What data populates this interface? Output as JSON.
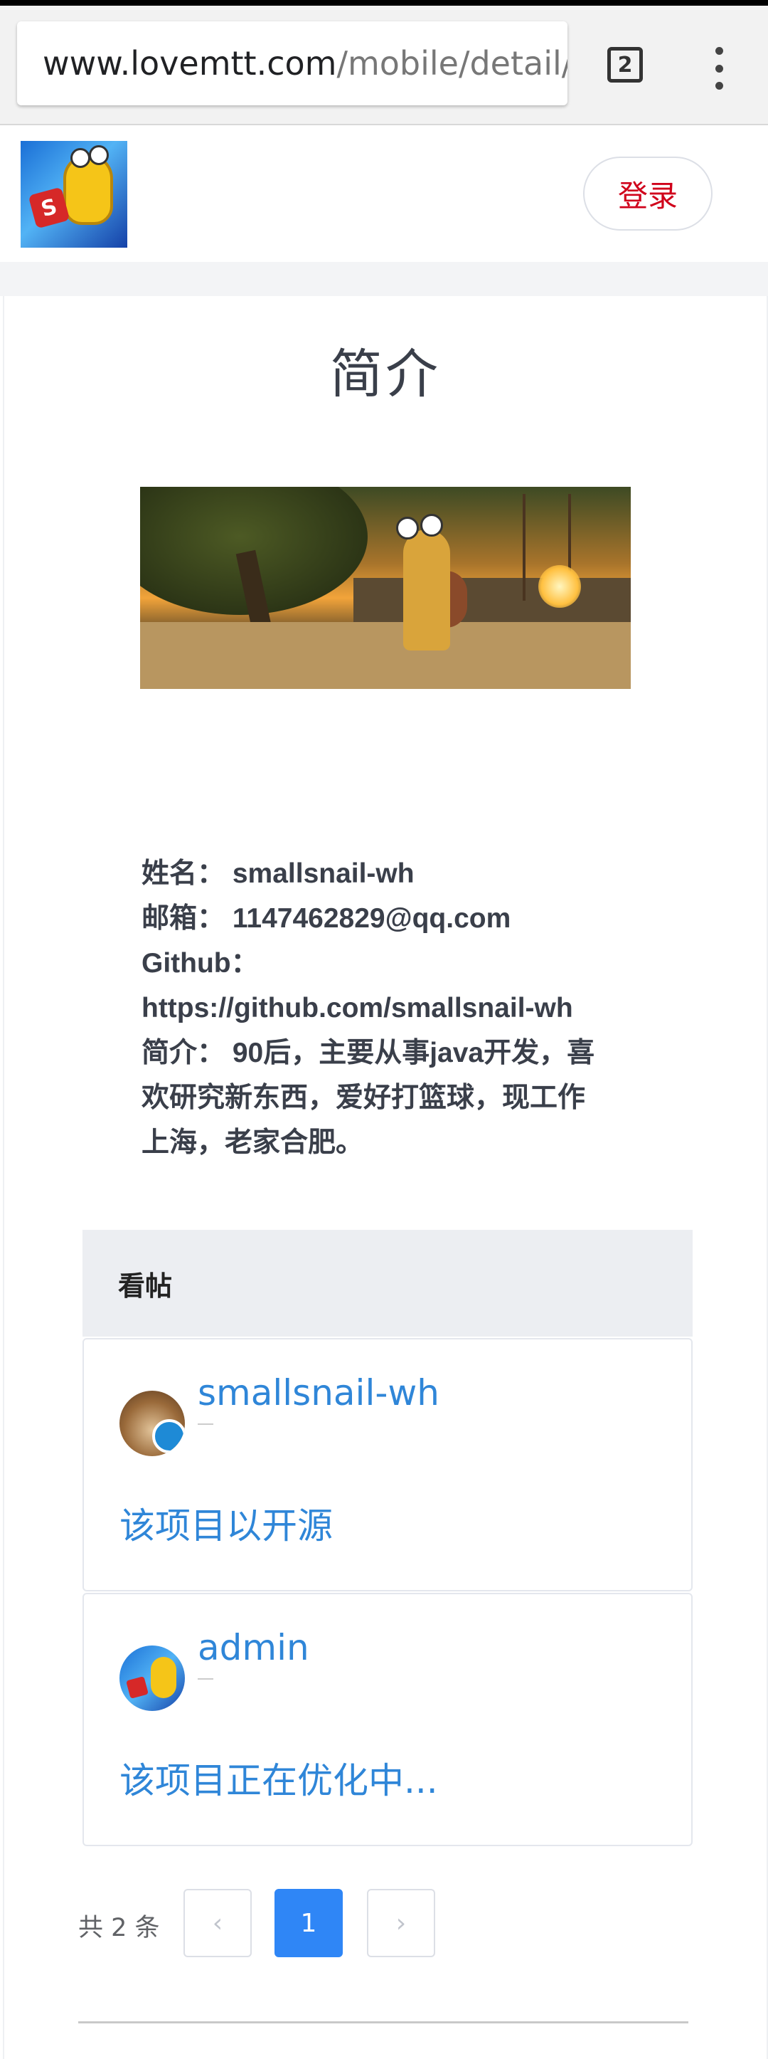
{
  "browser": {
    "url_host": "www.lovemtt.com",
    "url_path": "/mobile/detail/",
    "tab_count": "2"
  },
  "header": {
    "login_label": "登录",
    "logo_badge": "S"
  },
  "page": {
    "title": "简介"
  },
  "bio": {
    "name": "姓名： smallsnail-wh",
    "email": "邮箱： 1147462829@qq.com",
    "github_label": "Github：",
    "github_url": "https://github.com/smallsnail-wh",
    "intro_1": "简介： 90后，主要从事java开发，喜",
    "intro_2": "欢研究新东西，爱好打篮球，现工作",
    "intro_3": "上海，老家合肥。"
  },
  "posts": {
    "header": "看帖",
    "items": [
      {
        "author": "smallsnail-wh",
        "title": "该项目以开源"
      },
      {
        "author": "admin",
        "title": "该项目正在优化中..."
      }
    ]
  },
  "pagination": {
    "total": "共 2 条",
    "prev": "‹",
    "current": "1",
    "next": "›"
  }
}
